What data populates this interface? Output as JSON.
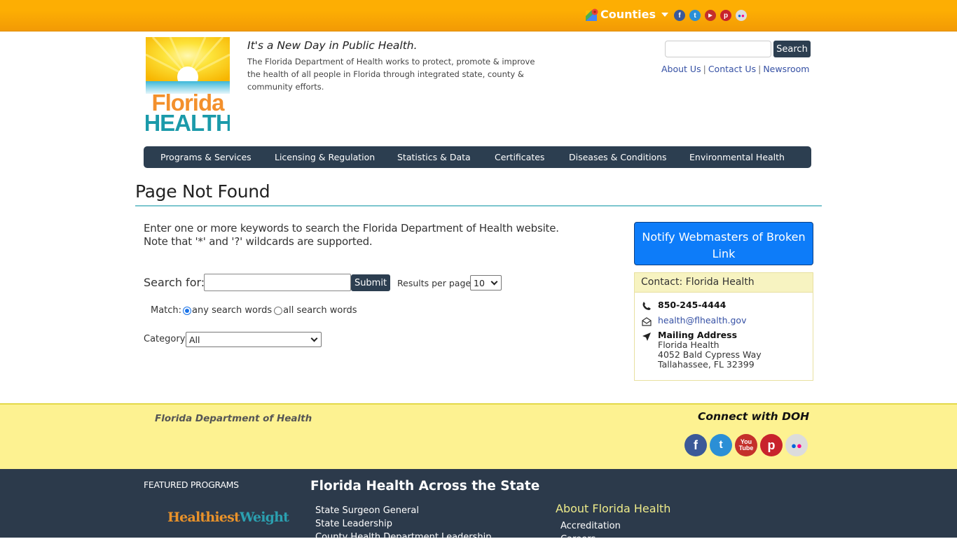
{
  "topbar": {
    "counties_label": "Counties",
    "social": [
      {
        "name": "facebook",
        "glyph": "f",
        "color": "#3b5998"
      },
      {
        "name": "twitter",
        "glyph": "t",
        "color": "#2b8fd6"
      },
      {
        "name": "youtube",
        "glyph": "▶",
        "color": "#c4302b"
      },
      {
        "name": "pinterest",
        "glyph": "p",
        "color": "#c8232c"
      },
      {
        "name": "flickr",
        "glyph": "••",
        "color": "#d8d8d8"
      }
    ]
  },
  "header": {
    "logo_top": "Florida",
    "logo_bottom": "HEALTH",
    "tagline": "It's a New Day in Public Health.",
    "description": "The Florida Department of Health works to protect, promote & improve the health of all people in Florida through integrated state, county & community efforts.",
    "search_value": "",
    "search_button": "Search",
    "links": [
      "About Us",
      "Contact Us",
      "Newsroom"
    ]
  },
  "nav": {
    "items": [
      "Programs & Services",
      "Licensing & Regulation",
      "Statistics & Data",
      "Certificates",
      "Diseases & Conditions",
      "Environmental Health"
    ]
  },
  "main": {
    "title": "Page Not Found",
    "intro_line1": "Enter one or more keywords to search the Florida Department of Health website.",
    "intro_line2": "Note that '*' and '?' wildcards are supported.",
    "search_for_label": "Search for:",
    "search_for_value": "",
    "submit_label": "Submit",
    "results_per_page_label": "Results per page:",
    "results_per_page_value": "10",
    "match_label": "Match:",
    "match_options": [
      {
        "label": "any search words",
        "selected": true
      },
      {
        "label": "all search words",
        "selected": false
      }
    ],
    "category_label": "Category:",
    "category_value": "All"
  },
  "sidebar": {
    "notify_button": "Notify Webmasters of Broken Link",
    "contact_title": "Contact: Florida Health",
    "phone": "850-245-4444",
    "email": "health@flhealth.gov",
    "address_title": "Mailing Address",
    "address_lines": [
      "Florida Health",
      "4052 Bald Cypress Way",
      "Tallahassee, FL 32399"
    ]
  },
  "footer": {
    "org_name": "Florida Department of Health",
    "connect_title": "Connect with DOH",
    "featured_title": "FEATURED PROGRAMS",
    "featured_logo_a": "Healthiest",
    "featured_logo_b": "Weight",
    "across_title": "Florida Health Across the State",
    "across_links": [
      "State Surgeon General",
      "State Leadership",
      "County Health Department Leadership"
    ],
    "about_title": "About Florida Health",
    "about_links": [
      "Accreditation",
      "Careers"
    ]
  }
}
